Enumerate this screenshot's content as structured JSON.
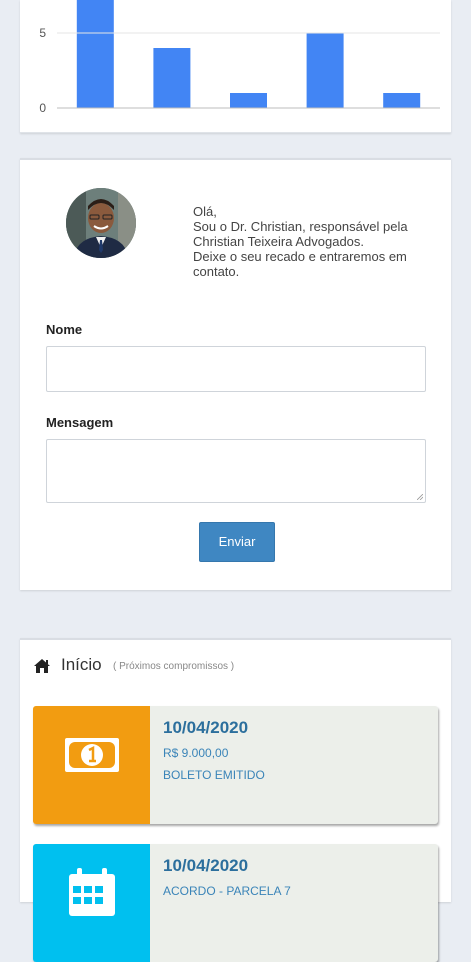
{
  "chart_data": {
    "type": "bar",
    "categories": [
      "",
      "",
      "",
      "",
      ""
    ],
    "values": [
      7.5,
      4,
      1,
      5,
      1
    ],
    "yticks": [
      "0",
      "5"
    ],
    "ylim": [
      0,
      7.2
    ],
    "colors": {
      "bar": "#4285f4",
      "grid": "#e6e6e6",
      "axis": "#bdbdbd",
      "tick": "#555555"
    }
  },
  "contact": {
    "greeting": [
      "Olá,",
      "Sou o Dr. Christian, responsável pela Christian Teixeira Advogados.",
      "Deixe o seu recado e entraremos em contato."
    ],
    "name_label": "Nome",
    "name_value": "",
    "message_label": "Mensagem",
    "message_value": "",
    "send_label": "Enviar"
  },
  "schedule": {
    "title": "Início",
    "subtitle": "( Próximos compromissos )",
    "events": [
      {
        "date": "10/04/2020",
        "line1": "R$ 9.000,00",
        "line2": "BOLETO EMITIDO",
        "icon": "money-icon",
        "color": "#f29c11"
      },
      {
        "date": "10/04/2020",
        "line1": "ACORDO - PARCELA 7",
        "line2": "",
        "icon": "calendar-icon",
        "color": "#00c0ef"
      }
    ]
  }
}
